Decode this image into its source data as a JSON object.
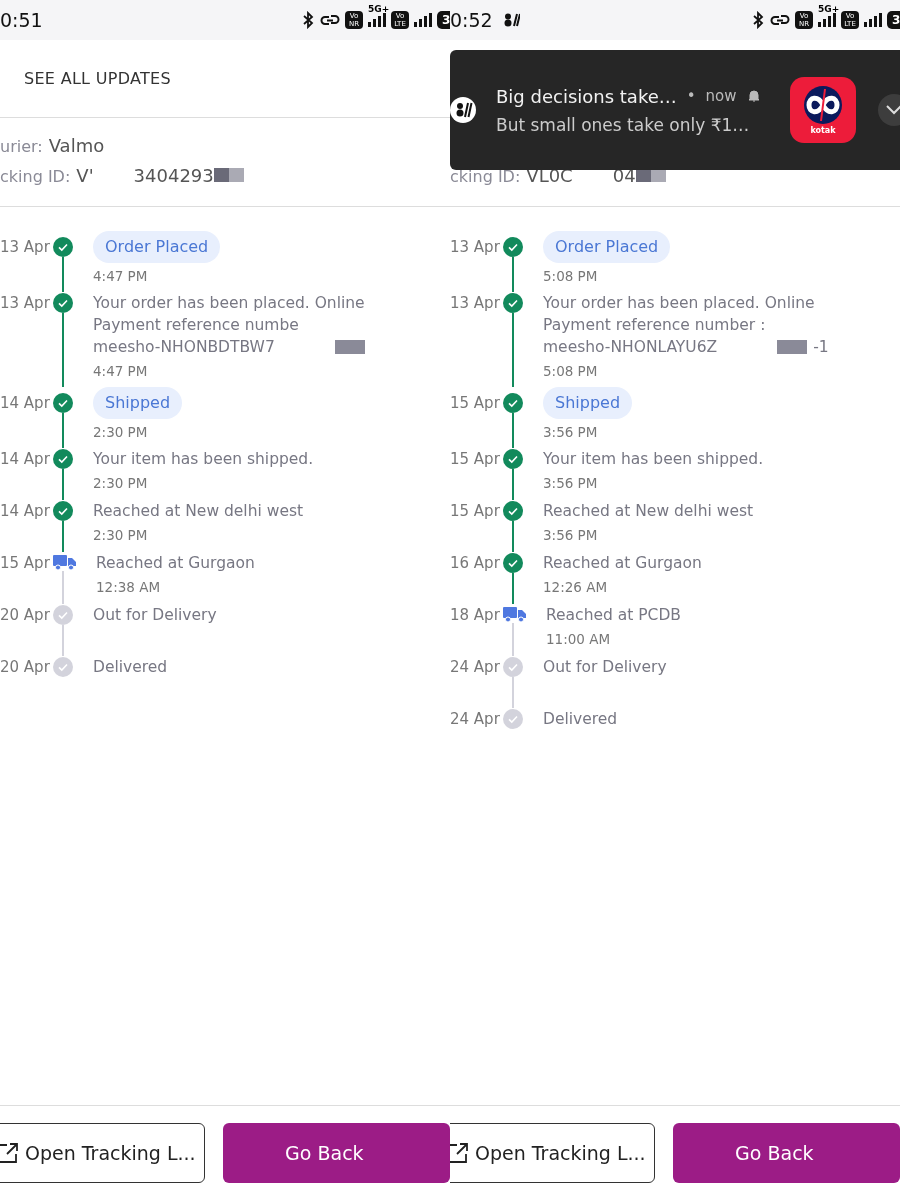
{
  "panels": [
    {
      "status_bar": {
        "time": "0:51",
        "network": [
          "Vo NR",
          "5G+",
          "Vo LTE"
        ],
        "battery": "3"
      },
      "header": {
        "title": "SEE ALL UPDATES"
      },
      "courier": {
        "label": "urier:",
        "value": "Valmo"
      },
      "tracking": {
        "label": "cking ID:",
        "parts": [
          "V'",
          "3404293"
        ]
      },
      "events": [
        {
          "date": "13 Apr",
          "kind": "chip",
          "completed": true,
          "in_transit": false,
          "title": "Order Placed",
          "time": "4:47 PM"
        },
        {
          "date": "13 Apr",
          "kind": "text",
          "completed": true,
          "in_transit": false,
          "title": "Your order has been placed. Online Payment reference numbe",
          "ref": "meesho-NHONBDTBW7",
          "time": "4:47 PM"
        },
        {
          "date": "14 Apr",
          "kind": "chip",
          "completed": true,
          "in_transit": false,
          "title": "Shipped",
          "time": "2:30 PM"
        },
        {
          "date": "14 Apr",
          "kind": "text",
          "completed": true,
          "in_transit": false,
          "title": "Your item has been shipped.",
          "time": "2:30 PM"
        },
        {
          "date": "14 Apr",
          "kind": "text",
          "completed": true,
          "in_transit": false,
          "title": "Reached at New delhi west",
          "time": "2:30 PM"
        },
        {
          "date": "15 Apr",
          "kind": "text",
          "completed": false,
          "in_transit": true,
          "title": "Reached at Gurgaon",
          "time": "12:38 AM"
        },
        {
          "date": "20 Apr",
          "kind": "text",
          "completed": false,
          "in_transit": false,
          "title": "Out for Delivery"
        },
        {
          "date": "20 Apr",
          "kind": "text",
          "completed": false,
          "in_transit": false,
          "title": "Delivered"
        }
      ],
      "buttons": {
        "secondary": "Open Tracking L...",
        "primary": "Go Back"
      }
    },
    {
      "status_bar": {
        "time": "0:52",
        "app_badge": true,
        "network": [
          "Vo NR",
          "5G+",
          "Vo LTE"
        ],
        "battery": "3"
      },
      "notification": {
        "title": "Big decisions take…",
        "separator": "•",
        "when": "now",
        "body": "But small ones take only ₹1…",
        "app_label": "kotak"
      },
      "tracking": {
        "label": "cking ID:",
        "parts": [
          "VL0C",
          "04"
        ]
      },
      "events": [
        {
          "date": "13 Apr",
          "kind": "chip",
          "completed": true,
          "in_transit": false,
          "title": "Order Placed",
          "time": "5:08 PM"
        },
        {
          "date": "13 Apr",
          "kind": "text",
          "completed": true,
          "in_transit": false,
          "title": "Your order has been placed. Online Payment reference number :",
          "ref": "meesho-NHONLAYU6Z",
          "ref_suffix": "-1",
          "time": "5:08 PM"
        },
        {
          "date": "15 Apr",
          "kind": "chip",
          "completed": true,
          "in_transit": false,
          "title": "Shipped",
          "time": "3:56 PM"
        },
        {
          "date": "15 Apr",
          "kind": "text",
          "completed": true,
          "in_transit": false,
          "title": "Your item has been shipped.",
          "time": "3:56 PM"
        },
        {
          "date": "15 Apr",
          "kind": "text",
          "completed": true,
          "in_transit": false,
          "title": "Reached at New delhi west",
          "time": "3:56 PM"
        },
        {
          "date": "16 Apr",
          "kind": "text",
          "completed": true,
          "in_transit": false,
          "title": "Reached at Gurgaon",
          "time": "12:26 AM"
        },
        {
          "date": "18 Apr",
          "kind": "text",
          "completed": false,
          "in_transit": true,
          "title": "Reached at PCDB",
          "time": "11:00 AM"
        },
        {
          "date": "24 Apr",
          "kind": "text",
          "completed": false,
          "in_transit": false,
          "title": "Out for Delivery"
        },
        {
          "date": "24 Apr",
          "kind": "text",
          "completed": false,
          "in_transit": false,
          "title": "Delivered"
        }
      ],
      "buttons": {
        "secondary": "Open Tracking L...",
        "primary": "Go Back"
      }
    }
  ]
}
